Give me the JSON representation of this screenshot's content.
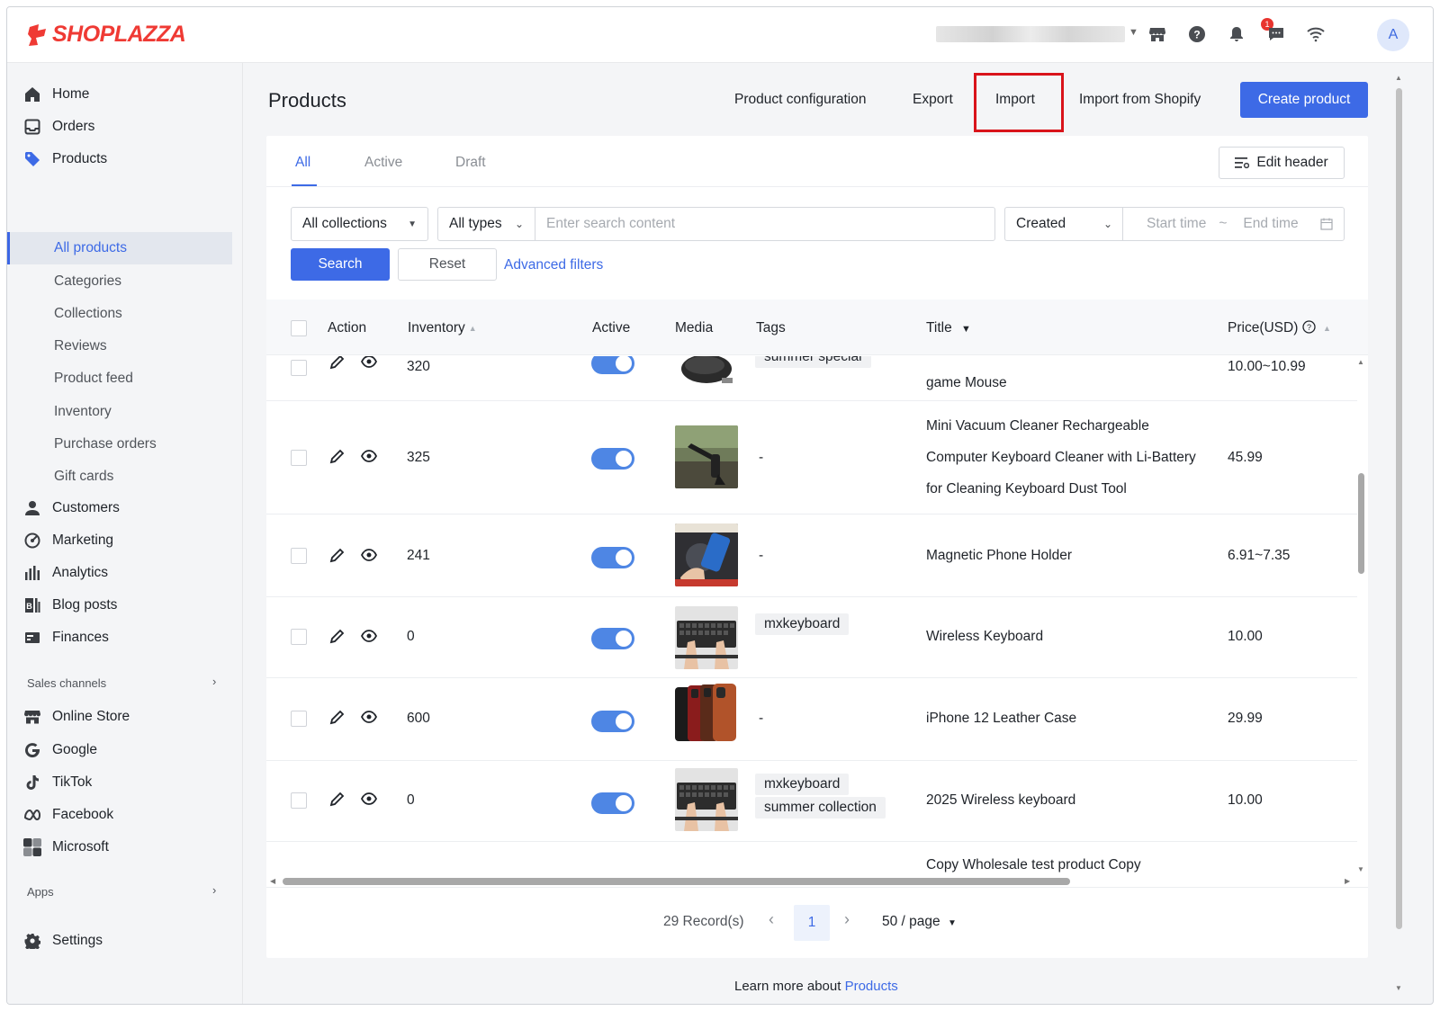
{
  "header": {
    "logo_text": "SHOPLAZZA",
    "notification_count": "1",
    "avatar_initial": "A"
  },
  "sidebar": {
    "items": [
      {
        "label": "Home",
        "icon": "home-icon"
      },
      {
        "label": "Orders",
        "icon": "orders-icon"
      },
      {
        "label": "Products",
        "icon": "tag-icon"
      }
    ],
    "product_subitems": [
      "All products",
      "Categories",
      "Collections",
      "Reviews",
      "Product feed",
      "Inventory",
      "Purchase orders",
      "Gift cards"
    ],
    "items2": [
      {
        "label": "Customers",
        "icon": "person-icon"
      },
      {
        "label": "Marketing",
        "icon": "marketing-icon"
      },
      {
        "label": "Analytics",
        "icon": "bar-chart-icon"
      },
      {
        "label": "Blog posts",
        "icon": "blog-icon"
      },
      {
        "label": "Finances",
        "icon": "finance-icon"
      }
    ],
    "sales_channels_label": "Sales channels",
    "channels": [
      {
        "label": "Online Store",
        "icon": "store-icon"
      },
      {
        "label": "Google",
        "icon": "google-icon"
      },
      {
        "label": "TikTok",
        "icon": "tiktok-icon"
      },
      {
        "label": "Facebook",
        "icon": "meta-icon"
      },
      {
        "label": "Microsoft",
        "icon": "microsoft-icon"
      }
    ],
    "apps_label": "Apps",
    "settings_label": "Settings"
  },
  "page": {
    "title": "Products",
    "actions": {
      "product_configuration": "Product configuration",
      "export": "Export",
      "import": "Import",
      "import_shopify": "Import from Shopify",
      "create_product": "Create product"
    },
    "tabs": [
      "All",
      "Active",
      "Draft"
    ],
    "edit_header": "Edit header"
  },
  "filters": {
    "collections": "All collections",
    "types": "All types",
    "search_placeholder": "Enter search content",
    "date_field": "Created",
    "start_time": "Start time",
    "tilde": "~",
    "end_time": "End time",
    "search_btn": "Search",
    "reset_btn": "Reset",
    "advanced": "Advanced filters"
  },
  "table": {
    "headers": {
      "action": "Action",
      "inventory": "Inventory",
      "active": "Active",
      "media": "Media",
      "tags": "Tags",
      "title": "Title",
      "price": "Price(USD)"
    },
    "rows": [
      {
        "inventory": "320",
        "tags": [
          "summer special"
        ],
        "title_lines": [
          "game Mouse"
        ],
        "price": "10.00~10.99",
        "active": true
      },
      {
        "inventory": "325",
        "tags": [],
        "tag_dash": "-",
        "title_lines": [
          "Mini Vacuum Cleaner Rechargeable",
          "Computer Keyboard Cleaner with Li-Battery",
          "for Cleaning Keyboard Dust Tool"
        ],
        "price": "45.99",
        "active": true
      },
      {
        "inventory": "241",
        "tags": [],
        "tag_dash": "-",
        "title_lines": [
          "Magnetic Phone Holder"
        ],
        "price": "6.91~7.35",
        "active": true
      },
      {
        "inventory": "0",
        "tags": [
          "mxkeyboard"
        ],
        "title_lines": [
          "Wireless Keyboard"
        ],
        "price": "10.00",
        "active": true
      },
      {
        "inventory": "600",
        "tags": [],
        "tag_dash": "-",
        "title_lines": [
          "iPhone 12 Leather Case"
        ],
        "price": "29.99",
        "active": true
      },
      {
        "inventory": "0",
        "tags": [
          "mxkeyboard",
          "summer collection"
        ],
        "title_lines": [
          "2025 Wireless keyboard"
        ],
        "price": "10.00",
        "active": true
      },
      {
        "inventory": "",
        "tags": [],
        "title_lines": [
          "Copy Wholesale test product Copy"
        ],
        "price": "",
        "active": true
      }
    ]
  },
  "pagination": {
    "records": "29 Record(s)",
    "current_page": "1",
    "page_size": "50 / page"
  },
  "footer": {
    "text": "Learn more about ",
    "link": "Products"
  },
  "colors": {
    "accent": "#3d6ae6",
    "brand": "#ef3a34",
    "highlight": "#d9141b",
    "toggle_on": "#4e86e4"
  }
}
